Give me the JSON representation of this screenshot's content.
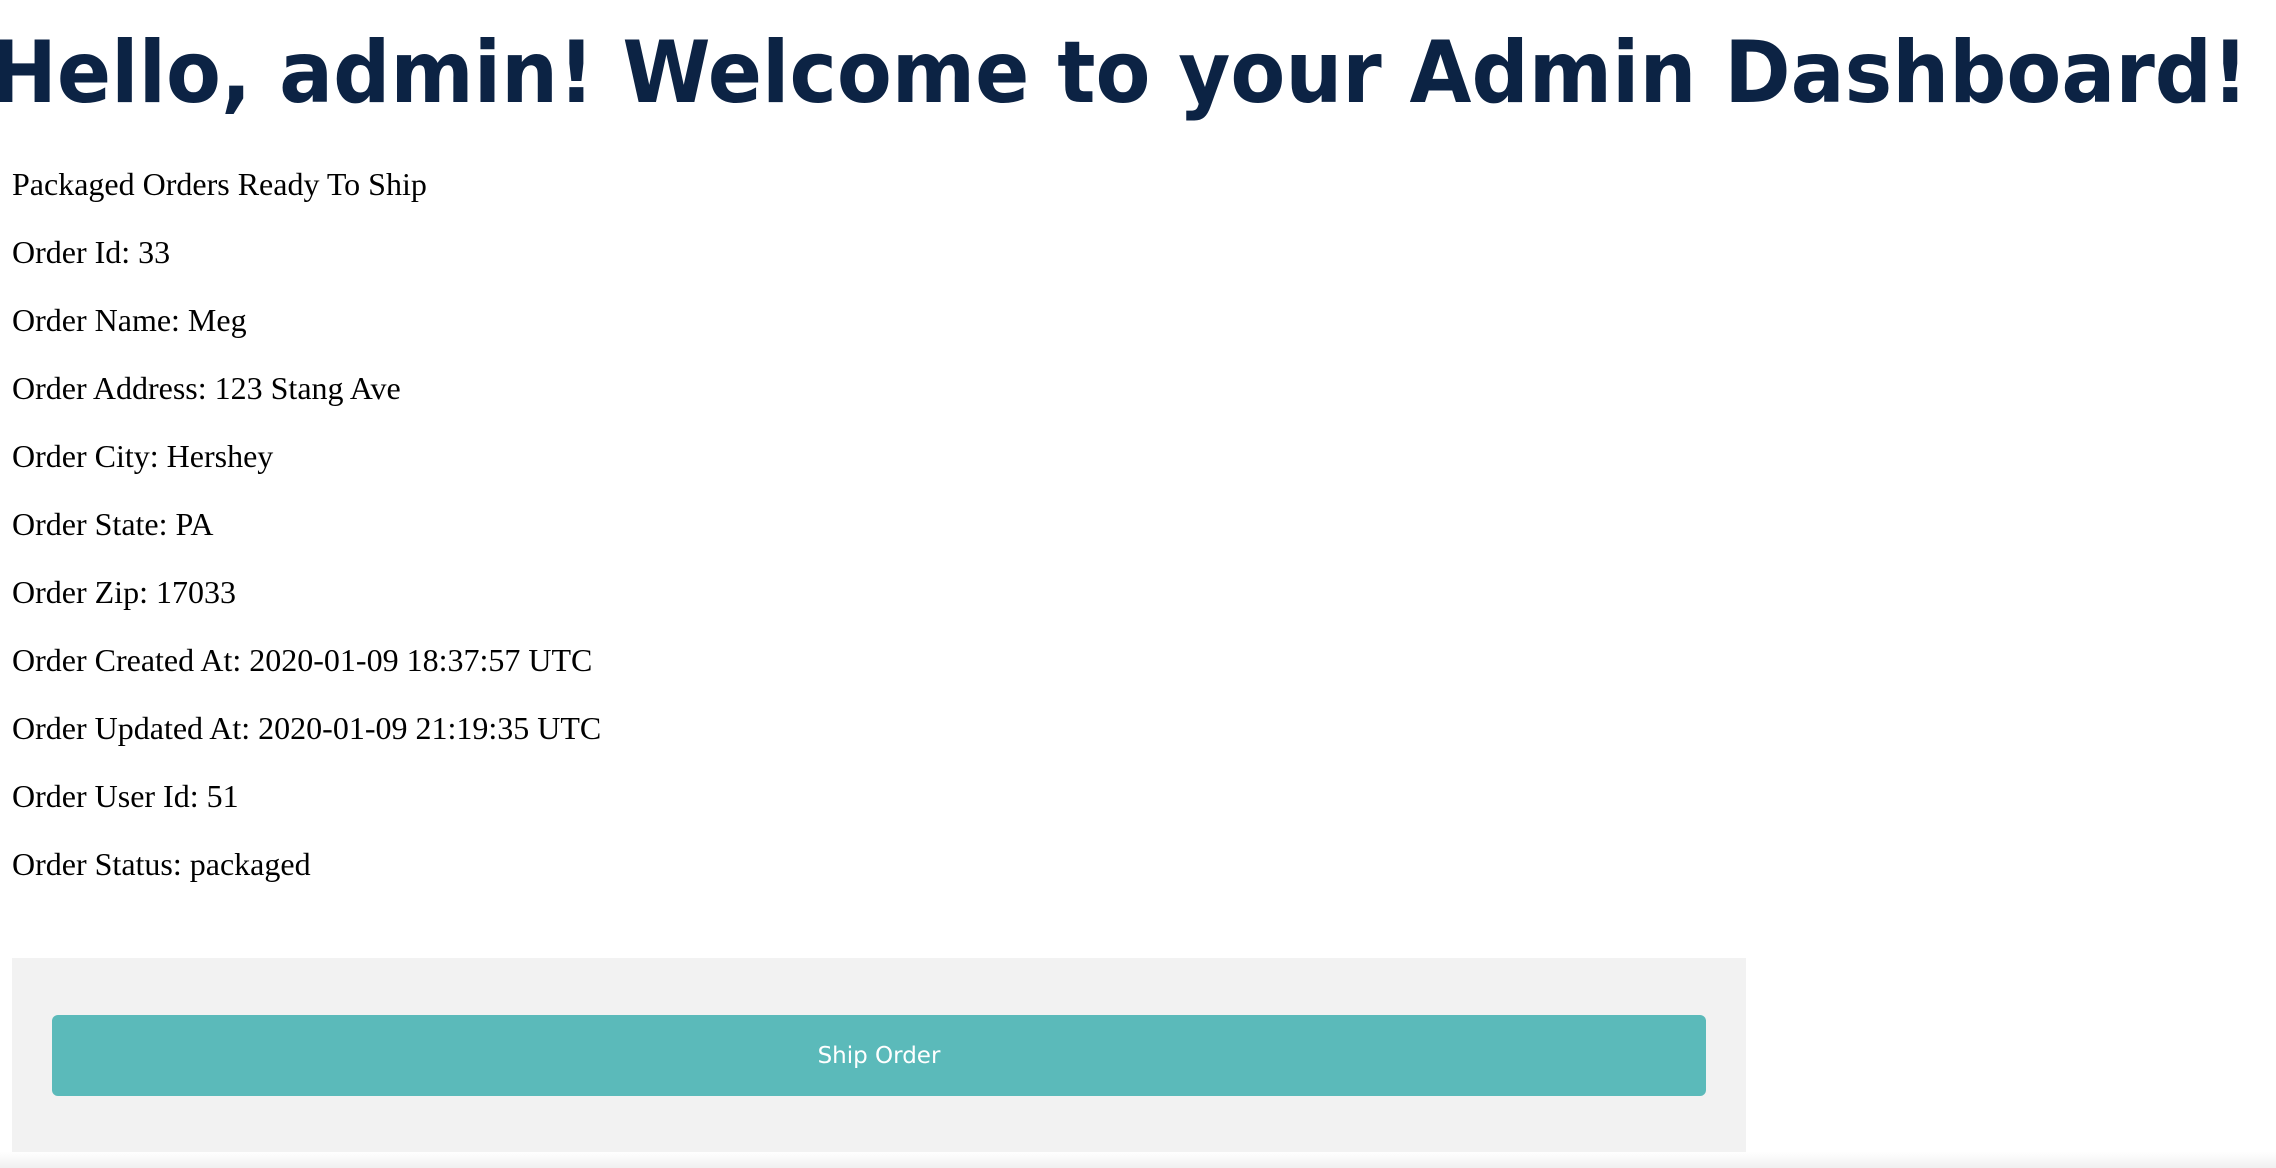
{
  "header": {
    "title": "Hello, admin! Welcome to your Admin Dashboard!"
  },
  "orders_section": {
    "heading": "Packaged Orders Ready To Ship",
    "order": {
      "id_label": "Order Id:",
      "id": "33",
      "name_label": "Order Name:",
      "name": "Meg",
      "address_label": "Order Address:",
      "address": "123 Stang Ave",
      "city_label": "Order City:",
      "city": "Hershey",
      "state_label": "Order State:",
      "state": "PA",
      "zip_label": "Order Zip:",
      "zip": "17033",
      "created_label": "Order Created At:",
      "created": "2020-01-09 18:37:57 UTC",
      "updated_label": "Order Updated At:",
      "updated": "2020-01-09 21:19:35 UTC",
      "user_id_label": "Order User Id:",
      "user_id": "51",
      "status_label": "Order Status:",
      "status": "packaged"
    },
    "ship_button_label": "Ship Order"
  },
  "colors": {
    "title": "#0c2344",
    "button": "#5bbaba",
    "panel": "#f2f2f2"
  }
}
